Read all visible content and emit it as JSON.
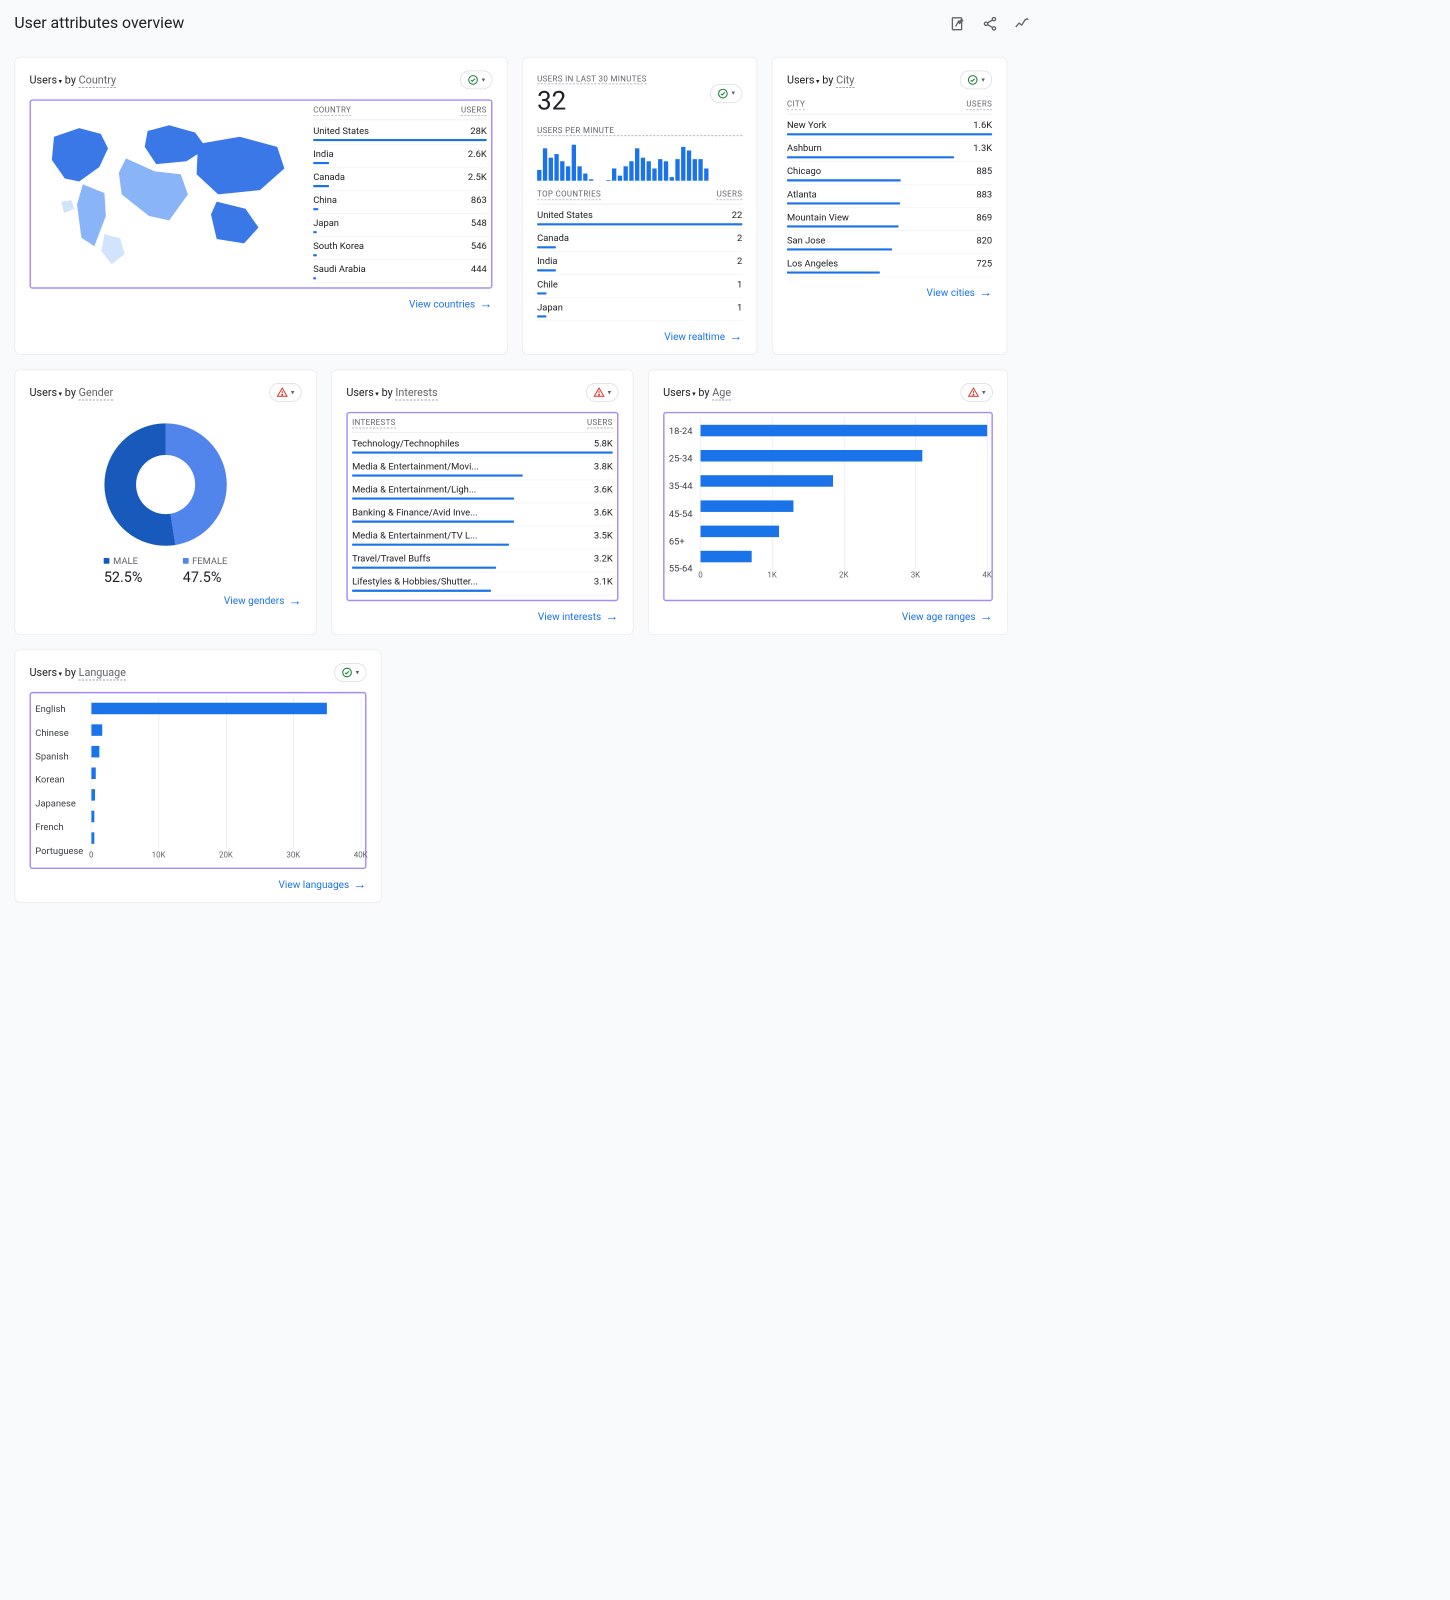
{
  "page_title": "User attributes overview",
  "labels": {
    "by": "by",
    "metric": "Users",
    "users_col": "USERS",
    "arrow": "→"
  },
  "cards": {
    "country": {
      "dim": "Country",
      "col": "COUNTRY",
      "footer": "View countries",
      "max": 28000,
      "rows": [
        {
          "name": "United States",
          "display": "28K",
          "value": 28000
        },
        {
          "name": "India",
          "display": "2.6K",
          "value": 2600
        },
        {
          "name": "Canada",
          "display": "2.5K",
          "value": 2500
        },
        {
          "name": "China",
          "display": "863",
          "value": 863
        },
        {
          "name": "Japan",
          "display": "548",
          "value": 548
        },
        {
          "name": "South Korea",
          "display": "546",
          "value": 546
        },
        {
          "name": "Saudi Arabia",
          "display": "444",
          "value": 444
        }
      ]
    },
    "realtime": {
      "title": "USERS IN LAST 30 MINUTES",
      "value": "32",
      "per_min_label": "USERS PER MINUTE",
      "spark": [
        30,
        90,
        65,
        75,
        55,
        40,
        100,
        40,
        20,
        5,
        0,
        0,
        3,
        35,
        15,
        40,
        55,
        90,
        65,
        55,
        35,
        60,
        55,
        10,
        60,
        95,
        85,
        60,
        60,
        35
      ],
      "top_col": "TOP COUNTRIES",
      "max": 22,
      "rows": [
        {
          "name": "United States",
          "display": "22",
          "value": 22
        },
        {
          "name": "Canada",
          "display": "2",
          "value": 2
        },
        {
          "name": "India",
          "display": "2",
          "value": 2
        },
        {
          "name": "Chile",
          "display": "1",
          "value": 1
        },
        {
          "name": "Japan",
          "display": "1",
          "value": 1
        }
      ],
      "footer": "View realtime"
    },
    "city": {
      "dim": "City",
      "col": "CITY",
      "footer": "View cities",
      "max": 1600,
      "rows": [
        {
          "name": "New York",
          "display": "1.6K",
          "value": 1600
        },
        {
          "name": "Ashburn",
          "display": "1.3K",
          "value": 1300
        },
        {
          "name": "Chicago",
          "display": "885",
          "value": 885
        },
        {
          "name": "Atlanta",
          "display": "883",
          "value": 883
        },
        {
          "name": "Mountain View",
          "display": "869",
          "value": 869
        },
        {
          "name": "San Jose",
          "display": "820",
          "value": 820
        },
        {
          "name": "Los Angeles",
          "display": "725",
          "value": 725
        }
      ]
    },
    "gender": {
      "dim": "Gender",
      "footer": "View genders",
      "male_label": "MALE",
      "female_label": "FEMALE",
      "male_pct": "52.5%",
      "female_pct": "47.5%"
    },
    "interests": {
      "dim": "Interests",
      "col": "INTERESTS",
      "footer": "View interests",
      "max": 5800,
      "rows": [
        {
          "name": "Technology/Technophiles",
          "display": "5.8K",
          "value": 5800
        },
        {
          "name": "Media & Entertainment/Movi...",
          "display": "3.8K",
          "value": 3800
        },
        {
          "name": "Media & Entertainment/Ligh...",
          "display": "3.6K",
          "value": 3600
        },
        {
          "name": "Banking & Finance/Avid Inve...",
          "display": "3.6K",
          "value": 3600
        },
        {
          "name": "Media & Entertainment/TV L...",
          "display": "3.5K",
          "value": 3500
        },
        {
          "name": "Travel/Travel Buffs",
          "display": "3.2K",
          "value": 3200
        },
        {
          "name": "Lifestyles & Hobbies/Shutter...",
          "display": "3.1K",
          "value": 3100
        }
      ]
    },
    "age": {
      "dim": "Age",
      "footer": "View age ranges",
      "ticks": [
        "0",
        "1K",
        "2K",
        "3K",
        "4K"
      ],
      "max": 4000,
      "rows": [
        {
          "name": "18-24",
          "value": 4050
        },
        {
          "name": "25-34",
          "value": 3100
        },
        {
          "name": "35-44",
          "value": 1850
        },
        {
          "name": "45-54",
          "value": 1300
        },
        {
          "name": "65+",
          "value": 1100
        },
        {
          "name": "55-64",
          "value": 720
        }
      ]
    },
    "language": {
      "dim": "Language",
      "footer": "View languages",
      "ticks": [
        "0",
        "10K",
        "20K",
        "30K",
        "40K"
      ],
      "max": 40000,
      "rows": [
        {
          "name": "English",
          "value": 35000
        },
        {
          "name": "Chinese",
          "value": 1600
        },
        {
          "name": "Spanish",
          "value": 1200
        },
        {
          "name": "Korean",
          "value": 700
        },
        {
          "name": "Japanese",
          "value": 550
        },
        {
          "name": "French",
          "value": 500
        },
        {
          "name": "Portuguese",
          "value": 450
        }
      ]
    }
  },
  "chart_data": [
    {
      "type": "table",
      "title": "Users by Country",
      "fields": [
        "Country",
        "Users"
      ],
      "rows": [
        [
          "United States",
          28000
        ],
        [
          "India",
          2600
        ],
        [
          "Canada",
          2500
        ],
        [
          "China",
          863
        ],
        [
          "Japan",
          548
        ],
        [
          "South Korea",
          546
        ],
        [
          "Saudi Arabia",
          444
        ]
      ]
    },
    {
      "type": "bar",
      "title": "Users per minute (last 30)",
      "categories": [
        1,
        2,
        3,
        4,
        5,
        6,
        7,
        8,
        9,
        10,
        11,
        12,
        13,
        14,
        15,
        16,
        17,
        18,
        19,
        20,
        21,
        22,
        23,
        24,
        25,
        26,
        27,
        28,
        29,
        30
      ],
      "values": [
        30,
        90,
        65,
        75,
        55,
        40,
        100,
        40,
        20,
        5,
        0,
        0,
        3,
        35,
        15,
        40,
        55,
        90,
        65,
        55,
        35,
        60,
        55,
        10,
        60,
        95,
        85,
        60,
        60,
        35
      ]
    },
    {
      "type": "table",
      "title": "Top Countries (realtime)",
      "fields": [
        "Country",
        "Users"
      ],
      "rows": [
        [
          "United States",
          22
        ],
        [
          "Canada",
          2
        ],
        [
          "India",
          2
        ],
        [
          "Chile",
          1
        ],
        [
          "Japan",
          1
        ]
      ]
    },
    {
      "type": "table",
      "title": "Users by City",
      "fields": [
        "City",
        "Users"
      ],
      "rows": [
        [
          "New York",
          1600
        ],
        [
          "Ashburn",
          1300
        ],
        [
          "Chicago",
          885
        ],
        [
          "Atlanta",
          883
        ],
        [
          "Mountain View",
          869
        ],
        [
          "San Jose",
          820
        ],
        [
          "Los Angeles",
          725
        ]
      ]
    },
    {
      "type": "pie",
      "title": "Users by Gender",
      "categories": [
        "Male",
        "Female"
      ],
      "values": [
        52.5,
        47.5
      ]
    },
    {
      "type": "table",
      "title": "Users by Interests",
      "fields": [
        "Interest",
        "Users"
      ],
      "rows": [
        [
          "Technology/Technophiles",
          5800
        ],
        [
          "Media & Entertainment/Movies",
          3800
        ],
        [
          "Media & Entertainment/Light",
          3600
        ],
        [
          "Banking & Finance/Avid Investors",
          3600
        ],
        [
          "Media & Entertainment/TV Lovers",
          3500
        ],
        [
          "Travel/Travel Buffs",
          3200
        ],
        [
          "Lifestyles & Hobbies/Shutterbugs",
          3100
        ]
      ]
    },
    {
      "type": "bar",
      "title": "Users by Age",
      "orientation": "horizontal",
      "xlim": [
        0,
        4000
      ],
      "categories": [
        "18-24",
        "25-34",
        "35-44",
        "45-54",
        "65+",
        "55-64"
      ],
      "values": [
        4050,
        3100,
        1850,
        1300,
        1100,
        720
      ],
      "xlabel": "",
      "ylabel": ""
    },
    {
      "type": "bar",
      "title": "Users by Language",
      "orientation": "horizontal",
      "xlim": [
        0,
        40000
      ],
      "categories": [
        "English",
        "Chinese",
        "Spanish",
        "Korean",
        "Japanese",
        "French",
        "Portuguese"
      ],
      "values": [
        35000,
        1600,
        1200,
        700,
        550,
        500,
        450
      ]
    }
  ]
}
